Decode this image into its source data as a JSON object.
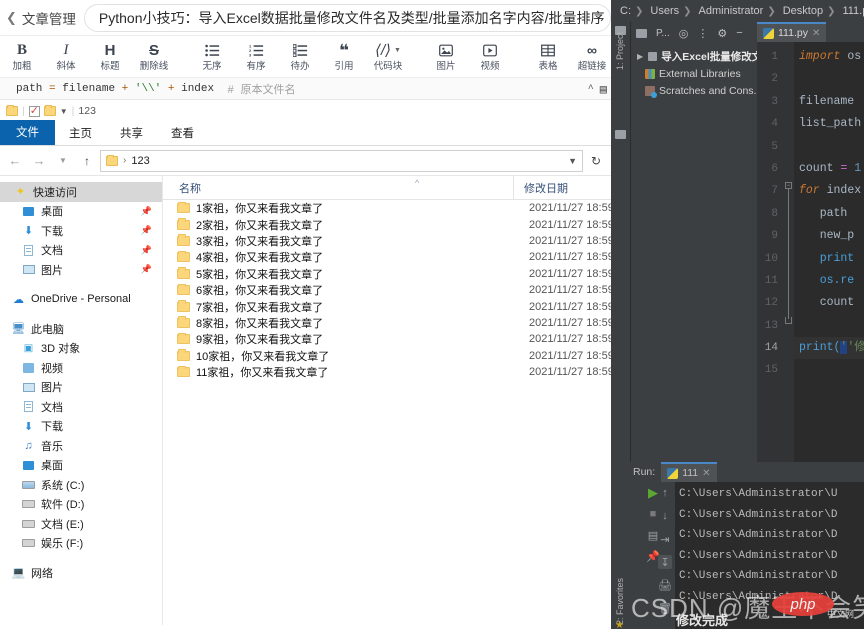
{
  "csdn": {
    "back_label": "文章管理",
    "article_title": "Python小技巧：导入Excel数据批量修改文件名及类型/批量添加名字内容/批量排序",
    "toolbar": [
      {
        "glyph": "B",
        "label": "加粗",
        "name": "bold"
      },
      {
        "glyph": "I",
        "label": "斜体",
        "name": "italic"
      },
      {
        "glyph": "H",
        "label": "标题",
        "name": "heading"
      },
      {
        "glyph": "S",
        "label": "删除线",
        "name": "strikethrough"
      },
      {
        "glyph": "≡",
        "label": "无序",
        "name": "unordered-list"
      },
      {
        "glyph": "≡",
        "label": "有序",
        "name": "ordered-list"
      },
      {
        "glyph": "≡",
        "label": "待办",
        "name": "todo-list"
      },
      {
        "glyph": "❝",
        "label": "引用",
        "name": "quote"
      },
      {
        "glyph": "⟨/⟩",
        "label": "代码块",
        "name": "code-block"
      },
      {
        "glyph": "▣",
        "label": "图片",
        "name": "image"
      },
      {
        "glyph": "▷",
        "label": "视频",
        "name": "video"
      },
      {
        "glyph": "▦",
        "label": "表格",
        "name": "table"
      },
      {
        "glyph": "🔗",
        "label": "超链接",
        "name": "hyperlink"
      }
    ],
    "code_line": {
      "p1": "path",
      "op1": "=",
      "p2": "filename",
      "op2": "+",
      "str": "'\\\\'",
      "op3": "+",
      "p3": "index",
      "comment": "# 原本文件名"
    },
    "editor_tab_fragment": "list_pat"
  },
  "explorer": {
    "quick_access_title": "123",
    "ribbon_tabs": [
      "文件",
      "主页",
      "共享",
      "查看"
    ],
    "address": {
      "folder": "",
      "sep": "›",
      "path": "123"
    },
    "nav": [
      {
        "label": "快速访问",
        "icon": "star-icon",
        "selected": true,
        "pin": false,
        "indent": 0
      },
      {
        "label": "桌面",
        "icon": "desktop-icon",
        "pin": true,
        "indent": 1
      },
      {
        "label": "下载",
        "icon": "download-icon",
        "pin": true,
        "indent": 1
      },
      {
        "label": "文档",
        "icon": "document-icon",
        "pin": true,
        "indent": 1
      },
      {
        "label": "图片",
        "icon": "picture-icon",
        "pin": true,
        "indent": 1
      },
      {
        "label": "OneDrive - Personal",
        "icon": "cloud-icon",
        "indent": 0,
        "spacer": true
      },
      {
        "label": "此电脑",
        "icon": "this-pc-icon",
        "indent": 0,
        "spacer": true
      },
      {
        "label": "3D 对象",
        "icon": "cube-icon",
        "indent": 1
      },
      {
        "label": "视频",
        "icon": "video-icon",
        "indent": 1
      },
      {
        "label": "图片",
        "icon": "picture-icon",
        "indent": 1
      },
      {
        "label": "文档",
        "icon": "document-icon",
        "indent": 1
      },
      {
        "label": "下载",
        "icon": "download-icon",
        "indent": 1
      },
      {
        "label": "音乐",
        "icon": "music-icon",
        "indent": 1
      },
      {
        "label": "桌面",
        "icon": "desktop-icon",
        "indent": 1
      },
      {
        "label": "系统 (C:)",
        "icon": "system-drive-icon",
        "indent": 1
      },
      {
        "label": "软件 (D:)",
        "icon": "drive-icon",
        "indent": 1
      },
      {
        "label": "文档 (E:)",
        "icon": "drive-icon",
        "indent": 1
      },
      {
        "label": "娱乐 (F:)",
        "icon": "drive-icon",
        "indent": 1
      },
      {
        "label": "网络",
        "icon": "network-icon",
        "indent": 0,
        "spacer": true
      }
    ],
    "columns": {
      "name": "名称",
      "date": "修改日期"
    },
    "files": [
      {
        "name": "1家祖，你又来看我文章了",
        "date": "2021/11/27 18:59"
      },
      {
        "name": "2家祖，你又来看我文章了",
        "date": "2021/11/27 18:59"
      },
      {
        "name": "3家祖，你又来看我文章了",
        "date": "2021/11/27 18:59"
      },
      {
        "name": "4家祖，你又来看我文章了",
        "date": "2021/11/27 18:59"
      },
      {
        "name": "5家祖，你又来看我文章了",
        "date": "2021/11/27 18:59"
      },
      {
        "name": "6家祖，你又来看我文章了",
        "date": "2021/11/27 18:59"
      },
      {
        "name": "7家祖，你又来看我文章了",
        "date": "2021/11/27 18:59"
      },
      {
        "name": "8家祖，你又来看我文章了",
        "date": "2021/11/27 18:59"
      },
      {
        "name": "9家祖，你又来看我文章了",
        "date": "2021/11/27 18:59"
      },
      {
        "name": "10家祖，你又来看我文章了",
        "date": "2021/11/27 18:59"
      },
      {
        "name": "11家祖，你又来看我文章了",
        "date": "2021/11/27 18:59"
      }
    ]
  },
  "pycharm": {
    "breadcrumb": [
      "C:",
      "Users",
      "Administrator",
      "Desktop",
      "111.p"
    ],
    "vertical_tab_project": "1: Project",
    "vertical_tab_favorites": "2: Favorites",
    "project_toolbar_label": "P...",
    "tree": [
      {
        "label": "导入Excel批量修改文...",
        "icon": "folder-icon",
        "expandable": true
      },
      {
        "label": "External Libraries",
        "icon": "libraries-icon"
      },
      {
        "label": "Scratches and Cons...",
        "icon": "scratches-icon"
      }
    ],
    "editor_tab": "111.py",
    "lines": [
      {
        "n": "1",
        "tokens": [
          {
            "t": "import",
            "c": "kw"
          },
          {
            "t": " os",
            "c": "id"
          }
        ]
      },
      {
        "n": "2",
        "tokens": []
      },
      {
        "n": "3",
        "tokens": [
          {
            "t": "filename",
            "c": "id"
          }
        ]
      },
      {
        "n": "4",
        "tokens": [
          {
            "t": "list_path",
            "c": "id"
          }
        ]
      },
      {
        "n": "5",
        "tokens": []
      },
      {
        "n": "6",
        "tokens": [
          {
            "t": "count ",
            "c": "id"
          },
          {
            "t": "= ",
            "c": "eq"
          },
          {
            "t": "1",
            "c": "num"
          }
        ]
      },
      {
        "n": "7",
        "tokens": [
          {
            "t": "for",
            "c": "kw"
          },
          {
            "t": " index",
            "c": "id"
          }
        ]
      },
      {
        "n": "8",
        "tokens": [
          {
            "t": "   path",
            "c": "id"
          }
        ]
      },
      {
        "n": "9",
        "tokens": [
          {
            "t": "   new_p",
            "c": "id"
          }
        ]
      },
      {
        "n": "10",
        "tokens": [
          {
            "t": "   print",
            "c": "fn"
          }
        ]
      },
      {
        "n": "11",
        "tokens": [
          {
            "t": "   os.re",
            "c": "id"
          }
        ]
      },
      {
        "n": "12",
        "tokens": [
          {
            "t": "   count",
            "c": "id"
          }
        ]
      },
      {
        "n": "13",
        "tokens": []
      },
      {
        "n": "14",
        "tokens": [
          {
            "t": "print(",
            "c": "fn"
          },
          {
            "t": "'",
            "c": "selstr"
          },
          {
            "t": "'修",
            "c": "str"
          }
        ],
        "highlight": true
      },
      {
        "n": "15",
        "tokens": []
      }
    ],
    "run": {
      "label": "Run:",
      "tab": "111",
      "console": [
        "C:\\Users\\Administrator\\U",
        "C:\\Users\\Administrator\\D",
        "C:\\Users\\Administrator\\D",
        "C:\\Users\\Administrator\\D",
        "C:\\Users\\Administrator\\D",
        "C:\\Users\\Administrator\\D"
      ]
    }
  },
  "watermarks": {
    "csdn": "CSDN @魔王不会笑",
    "done": "修改完成",
    "php": "php",
    "php_zh": "中文网"
  },
  "colors": {
    "accent_blue": "#0b63ad",
    "pycharm_bg": "#3c3f41",
    "editor_bg": "#2b2b2b",
    "keyword_orange": "#cc7832",
    "string_green": "#6a8759",
    "number_blue": "#6897bb",
    "folder_yellow": "#fcd67b"
  }
}
